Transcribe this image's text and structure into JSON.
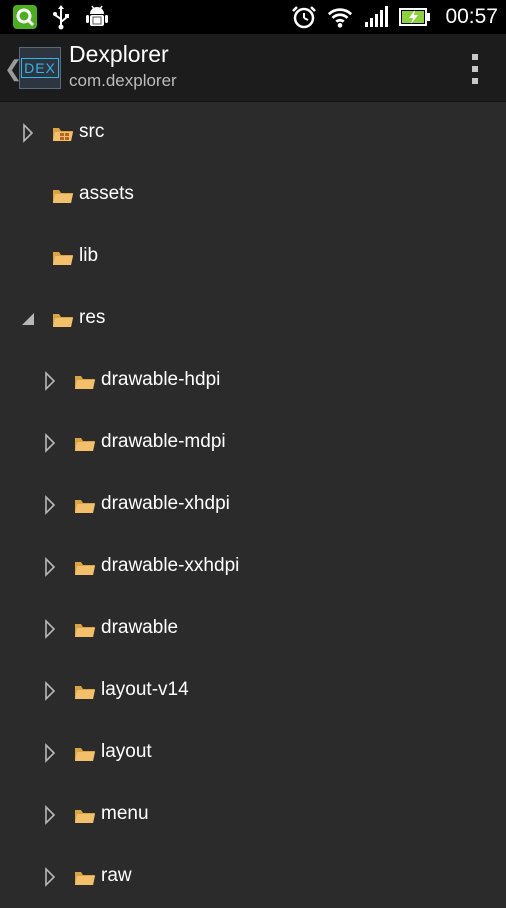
{
  "status_bar": {
    "left_icons": [
      "quicklook-app-icon",
      "usb-icon",
      "android-debug-icon"
    ],
    "right_icons": [
      "alarm-clock-icon",
      "wifi-icon",
      "signal-icon",
      "battery-charging-icon"
    ],
    "time": "00:57"
  },
  "action_bar": {
    "title": "Dexplorer",
    "subtitle": "com.dexplorer",
    "logo_text": "DEX",
    "accent": "#33b5e5"
  },
  "tree": [
    {
      "label": "src",
      "depth": 0,
      "expander": "collapsed",
      "icon": "package-folder-icon"
    },
    {
      "label": "assets",
      "depth": 0,
      "expander": "none",
      "icon": "folder-icon"
    },
    {
      "label": "lib",
      "depth": 0,
      "expander": "none",
      "icon": "folder-icon"
    },
    {
      "label": "res",
      "depth": 0,
      "expander": "expanded",
      "icon": "folder-icon"
    },
    {
      "label": "drawable-hdpi",
      "depth": 1,
      "expander": "collapsed",
      "icon": "folder-icon"
    },
    {
      "label": "drawable-mdpi",
      "depth": 1,
      "expander": "collapsed",
      "icon": "folder-icon"
    },
    {
      "label": "drawable-xhdpi",
      "depth": 1,
      "expander": "collapsed",
      "icon": "folder-icon"
    },
    {
      "label": "drawable-xxhdpi",
      "depth": 1,
      "expander": "collapsed",
      "icon": "folder-icon"
    },
    {
      "label": "drawable",
      "depth": 1,
      "expander": "collapsed",
      "icon": "folder-icon"
    },
    {
      "label": "layout-v14",
      "depth": 1,
      "expander": "collapsed",
      "icon": "folder-icon"
    },
    {
      "label": "layout",
      "depth": 1,
      "expander": "collapsed",
      "icon": "folder-icon"
    },
    {
      "label": "menu",
      "depth": 1,
      "expander": "collapsed",
      "icon": "folder-icon"
    },
    {
      "label": "raw",
      "depth": 1,
      "expander": "collapsed",
      "icon": "folder-icon"
    }
  ],
  "colors": {
    "background": "#2b2b2b",
    "action_bar": "#1c1c1c",
    "folder": "#f2c06a",
    "expander": "#b8b8b8"
  }
}
